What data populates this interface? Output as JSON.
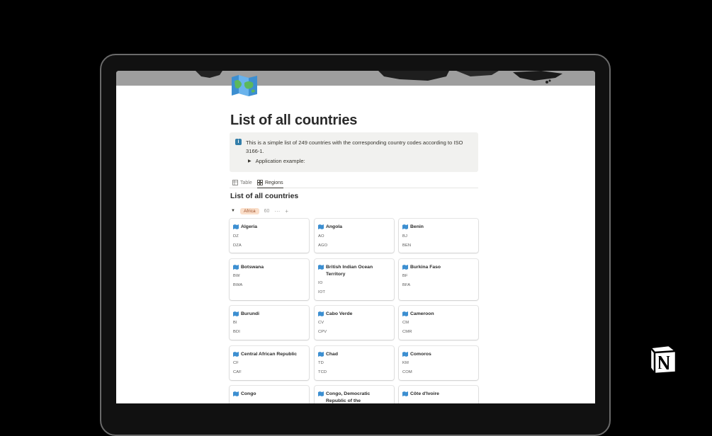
{
  "page": {
    "title": "List of all countries",
    "icon": "folded-map-icon"
  },
  "callout": {
    "icon": "info-icon",
    "text": "This is a simple list of 249 countries with the corresponding country codes according to ISO 3166-1.",
    "toggle_label": "Application example:"
  },
  "views": {
    "tabs": [
      {
        "label": "Table",
        "icon": "table-icon",
        "active": false
      },
      {
        "label": "Regions",
        "icon": "gallery-icon",
        "active": true
      }
    ]
  },
  "database": {
    "title": "List of all countries"
  },
  "group": {
    "label": "Africa",
    "count": "60",
    "more": "···",
    "add": "+"
  },
  "cards": [
    {
      "name": "Algeria",
      "alpha2": "DZ",
      "alpha3": "DZA"
    },
    {
      "name": "Angola",
      "alpha2": "AO",
      "alpha3": "AGO"
    },
    {
      "name": "Benin",
      "alpha2": "BJ",
      "alpha3": "BEN"
    },
    {
      "name": "Botswana",
      "alpha2": "BW",
      "alpha3": "BWA"
    },
    {
      "name": "British Indian Ocean Territory",
      "alpha2": "IO",
      "alpha3": "IOT"
    },
    {
      "name": "Burkina Faso",
      "alpha2": "BF",
      "alpha3": "BFA"
    },
    {
      "name": "Burundi",
      "alpha2": "BI",
      "alpha3": "BDI"
    },
    {
      "name": "Cabo Verde",
      "alpha2": "CV",
      "alpha3": "CPV"
    },
    {
      "name": "Cameroon",
      "alpha2": "CM",
      "alpha3": "CMR"
    },
    {
      "name": "Central African Republic",
      "alpha2": "CF",
      "alpha3": "CAF"
    },
    {
      "name": "Chad",
      "alpha2": "TD",
      "alpha3": "TCD"
    },
    {
      "name": "Comoros",
      "alpha2": "KM",
      "alpha3": "COM"
    },
    {
      "name": "Congo",
      "alpha2": "",
      "alpha3": ""
    },
    {
      "name": "Congo, Democratic Republic of the",
      "alpha2": "",
      "alpha3": ""
    },
    {
      "name": "Côte d'Ivoire",
      "alpha2": "",
      "alpha3": ""
    }
  ],
  "colors": {
    "background": "#000000",
    "page": "#ffffff",
    "callout_bg": "#f1f1ef",
    "tag_bg": "#fadec9",
    "tag_text": "#a0522d",
    "info_blue": "#337ea9"
  },
  "brand": {
    "logo": "notion-logo-icon"
  }
}
